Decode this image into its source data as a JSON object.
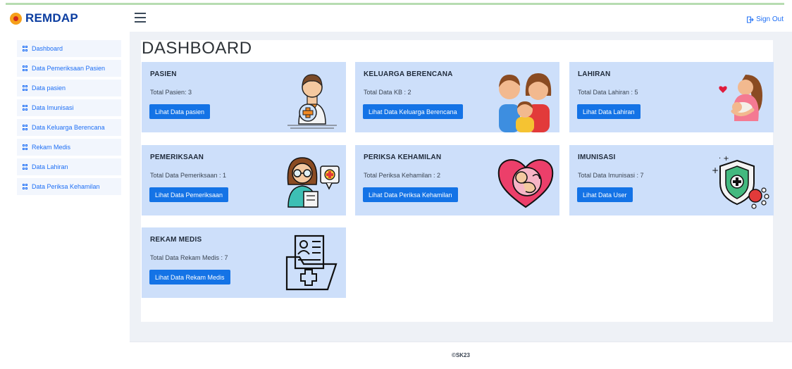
{
  "brand": {
    "name": "REMDAP"
  },
  "header": {
    "signout_label": "Sign Out"
  },
  "sidebar": {
    "items": [
      {
        "label": "Dashboard"
      },
      {
        "label": "Data Pemeriksaan Pasien"
      },
      {
        "label": "Data pasien"
      },
      {
        "label": "Data Imunisasi"
      },
      {
        "label": "Data Keluarga Berencana"
      },
      {
        "label": "Rekam Medis"
      },
      {
        "label": "Data Lahiran"
      },
      {
        "label": "Data Periksa Kehamilan"
      }
    ]
  },
  "main": {
    "title": "DASHBOARD",
    "cards": [
      {
        "title": "PASIEN",
        "text": "Total Pasien: 3",
        "button": "Lihat Data pasien",
        "icon": "doctor-icon"
      },
      {
        "title": "KELUARGA BERENCANA",
        "text": "Total Data KB : 2",
        "button": "Lihat Data Keluarga Berencana",
        "icon": "family-icon"
      },
      {
        "title": "LAHIRAN",
        "text": "Total Data Lahiran : 5",
        "button": "Lihat Data Lahiran",
        "icon": "mother-baby-icon"
      },
      {
        "title": "PEMERIKSAAN",
        "text": "Total Data Pemeriksaan : 1",
        "button": "Lihat Data Pemeriksaan",
        "icon": "medical-consult-icon"
      },
      {
        "title": "PERIKSA KEHAMILAN",
        "text": "Total Periksa Kehamilan : 2",
        "button": "Lihat Data Periksa Kehamilan",
        "icon": "pregnancy-heart-icon"
      },
      {
        "title": "IMUNISASI",
        "text": "Total Data Imunisasi : 7",
        "button": "Lihat Data User",
        "icon": "vaccine-shield-icon"
      },
      {
        "title": "REKAM MEDIS",
        "text": "Total Data Rekam Medis : 7",
        "button": "Lihat Data Rekam Medis",
        "icon": "medical-record-folder-icon"
      }
    ]
  },
  "footer": {
    "text": "©SK23"
  },
  "colors": {
    "accent": "#1473e6",
    "card_bg": "#cddffa",
    "brand": "#0b3da0"
  }
}
